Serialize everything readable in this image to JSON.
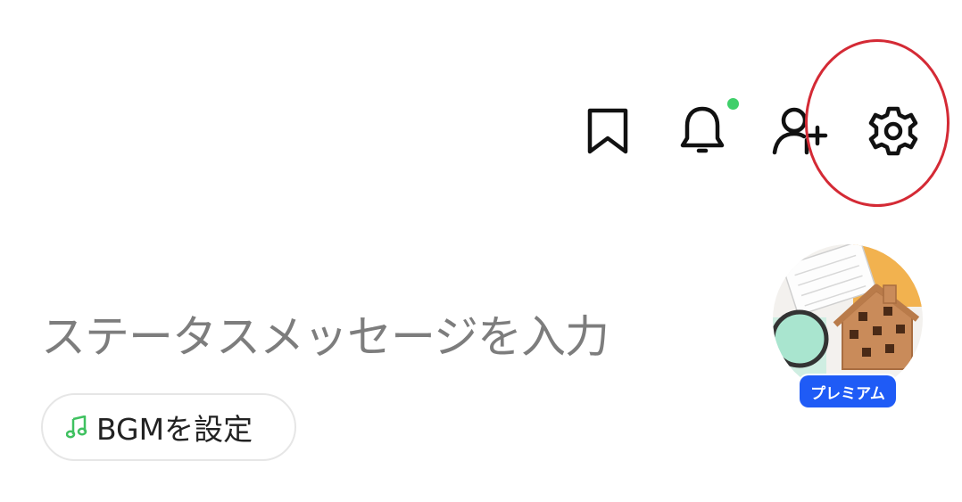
{
  "header": {
    "icons": [
      {
        "name": "bookmark-icon"
      },
      {
        "name": "bell-icon",
        "has_notification": true
      },
      {
        "name": "add-friend-icon"
      },
      {
        "name": "settings-icon"
      }
    ],
    "notification_dot_color": "#3fcf6a",
    "highlight_ring_color": "#d42a35"
  },
  "profile": {
    "status_placeholder": "ステータスメッセージを入力",
    "bgm_button_label": "BGMを設定",
    "bgm_icon": "music-note-icon",
    "premium_badge": "プレミアム",
    "badge_color": "#1f5bf6"
  }
}
